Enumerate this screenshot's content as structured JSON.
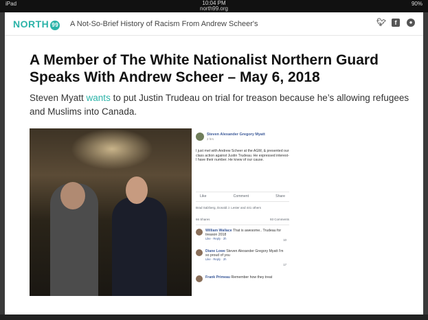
{
  "statusbar": {
    "device": "iPad",
    "time": "10:04 PM",
    "url": "north99.org",
    "battery": "90%"
  },
  "header": {
    "logo_text": "NORTH",
    "logo_number": "99",
    "site_title": "A Not-So-Brief History of Racism From Andrew Scheer's",
    "social_icons": [
      "twitter-icon",
      "facebook-icon",
      "reddit-icon"
    ]
  },
  "article": {
    "headline": "A Member of The White Nationalist Northern Guard Speaks With Andrew Scheer – May 6, 2018",
    "sub_before": "Steven Myatt ",
    "sub_link": "wants",
    "sub_after": " to put Justin Trudeau on trial for treason because he’s allowing refugees and Muslims into Canada."
  },
  "fbpost": {
    "author": "Steven Alexander Gregory Myatt",
    "time": "2 hrs",
    "body": "I just met with Andrew Scheer at the AGM, & presented our class action against Justin Trudeau. He expressed interest- I have their number. He knew of our cause.",
    "actions": [
      "Like",
      "Comment",
      "Share"
    ],
    "reactions": "Brad Salzberg, Donald J. Lester and 441 others",
    "shares": "66 Shares",
    "comments_count": "93 Comments",
    "comments": [
      {
        "name": "William Wallace",
        "text": "That is awesome.. Trudeau for treason 2018",
        "meta": "Like · Reply · 2h",
        "count": "10"
      },
      {
        "name": "Diane Lowe",
        "text": "Steven Alexander Gregory Myatt I'm so proud of you",
        "meta": "Like · Reply · 2h",
        "count": "17"
      },
      {
        "name": "Frank Primeau",
        "text": "Remember how they treat",
        "meta": "",
        "count": ""
      }
    ]
  },
  "colors": {
    "accent": "#2bb3a8",
    "facebook": "#3b5998"
  }
}
